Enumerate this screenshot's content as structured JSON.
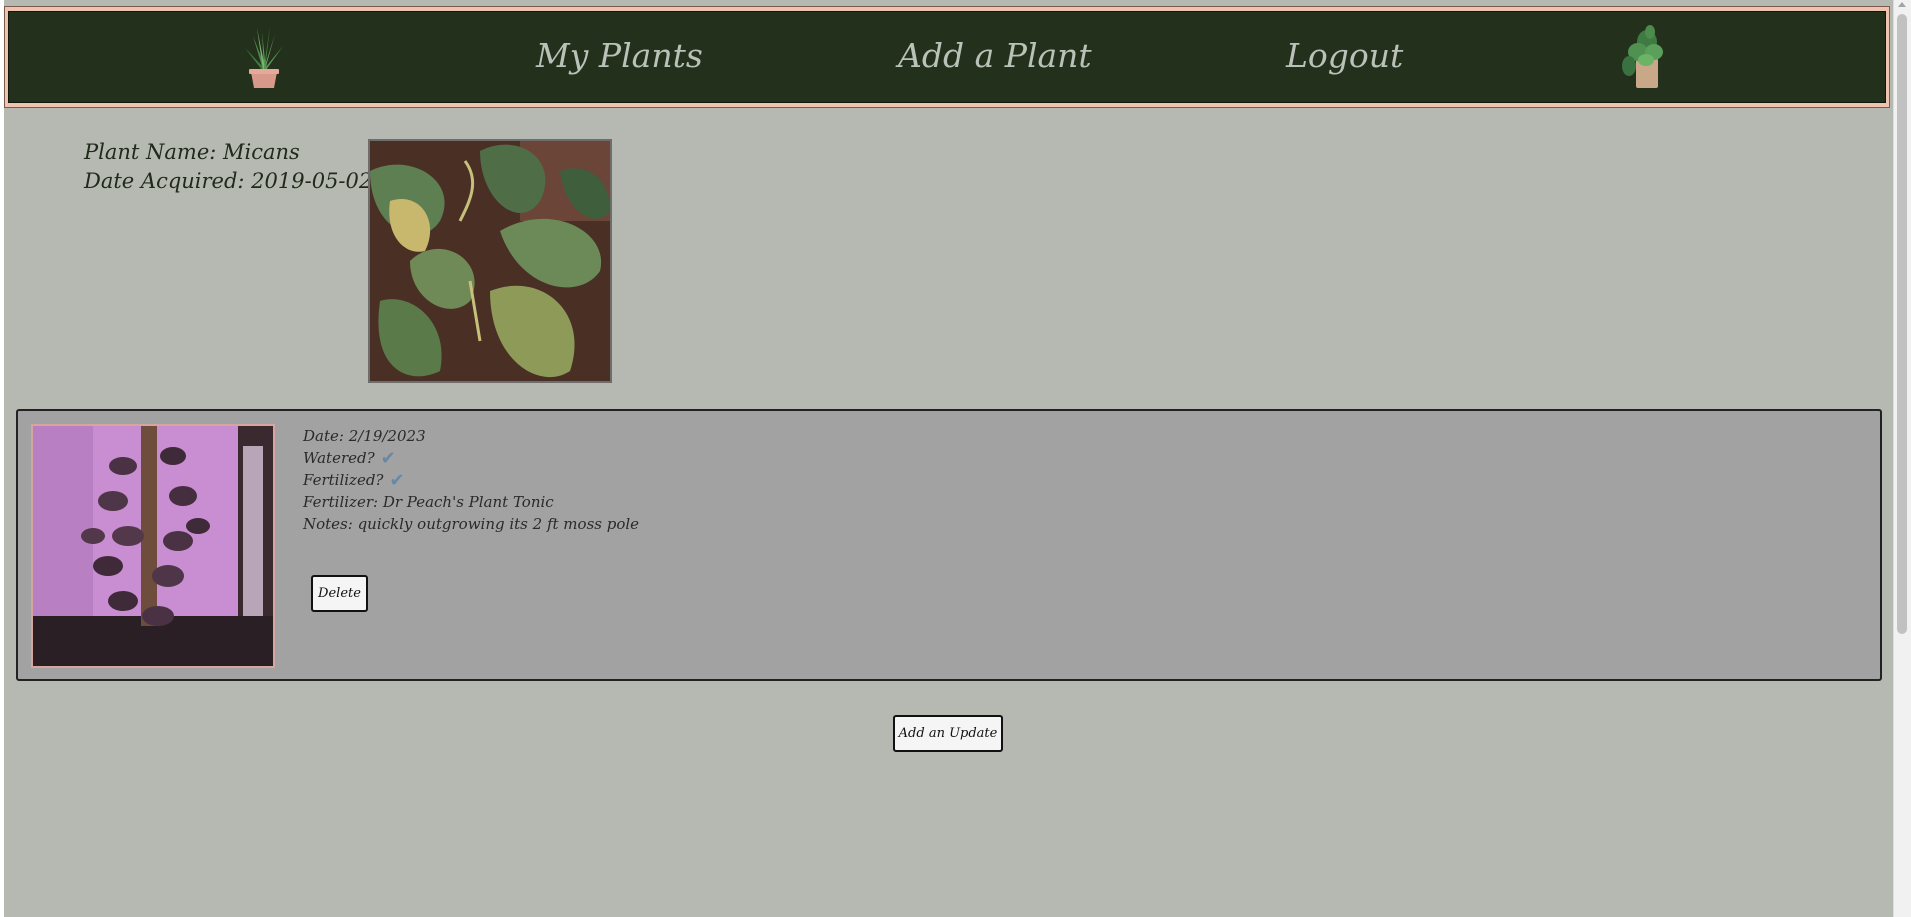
{
  "nav": {
    "left_icon": "aloe-pot-icon",
    "links": [
      {
        "label": "My Plants"
      },
      {
        "label": "Add a Plant"
      },
      {
        "label": "Logout"
      }
    ],
    "right_icon": "potted-plant-icon"
  },
  "plant": {
    "name_line": "Plant Name: Micans",
    "date_line": "Date Acquired: 2019-05-02",
    "photo_icon": "philodendron-leaves-photo"
  },
  "updates": [
    {
      "photo_icon": "climbing-plant-moss-pole-photo",
      "date_line": "Date: 2/19/2023",
      "watered_label": "Watered?",
      "watered_check": "✔",
      "fertilized_label": "Fertilized?",
      "fertilized_check": "✔",
      "fertilizer_line": "Fertilizer: Dr Peach's Plant Tonic",
      "notes_line": "Notes: quickly outgrowing its 2 ft moss pole",
      "delete_label": "Delete"
    }
  ],
  "actions": {
    "add_update_label": "Add an Update"
  },
  "colors": {
    "page_bg": "#b6b9b1",
    "nav_bg": "#23301b",
    "nav_border": "#f0c2b0",
    "nav_text": "#b9c1b8",
    "card_bg": "#a2a2a2",
    "check": "#6689a6"
  }
}
